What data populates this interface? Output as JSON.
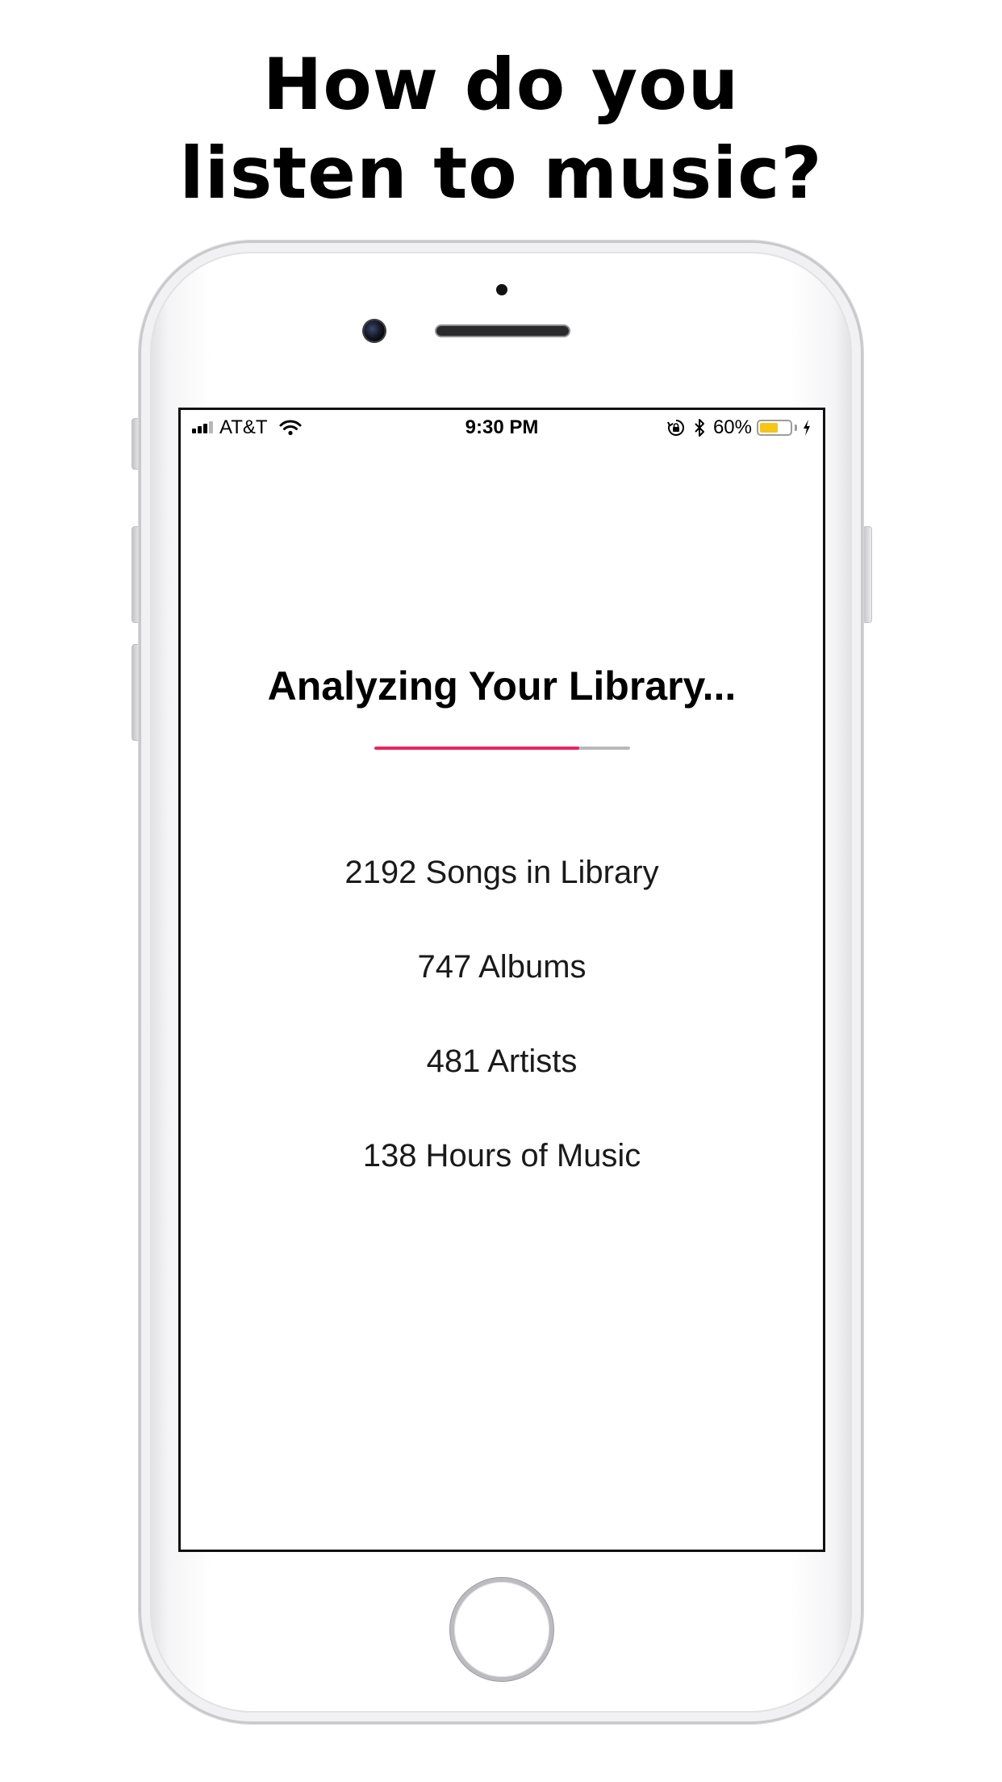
{
  "headline": {
    "line1": "How do you",
    "line2": "listen to music?"
  },
  "status_bar": {
    "carrier": "AT&T",
    "time": "9:30 PM",
    "battery_percent_label": "60%",
    "battery_level": 0.6,
    "icons": [
      "signal-icon",
      "wifi-icon",
      "orientation-lock-icon",
      "bluetooth-icon",
      "battery-icon",
      "charging-bolt-icon"
    ]
  },
  "app": {
    "title": "Analyzing Your Library...",
    "progress": 0.8,
    "stats": [
      "2192 Songs in Library",
      "747 Albums",
      "481 Artists",
      "138 Hours of Music"
    ]
  },
  "colors": {
    "accent": "#e8265e",
    "progress_track": "#b9b9b9",
    "battery": "#f5c518"
  }
}
